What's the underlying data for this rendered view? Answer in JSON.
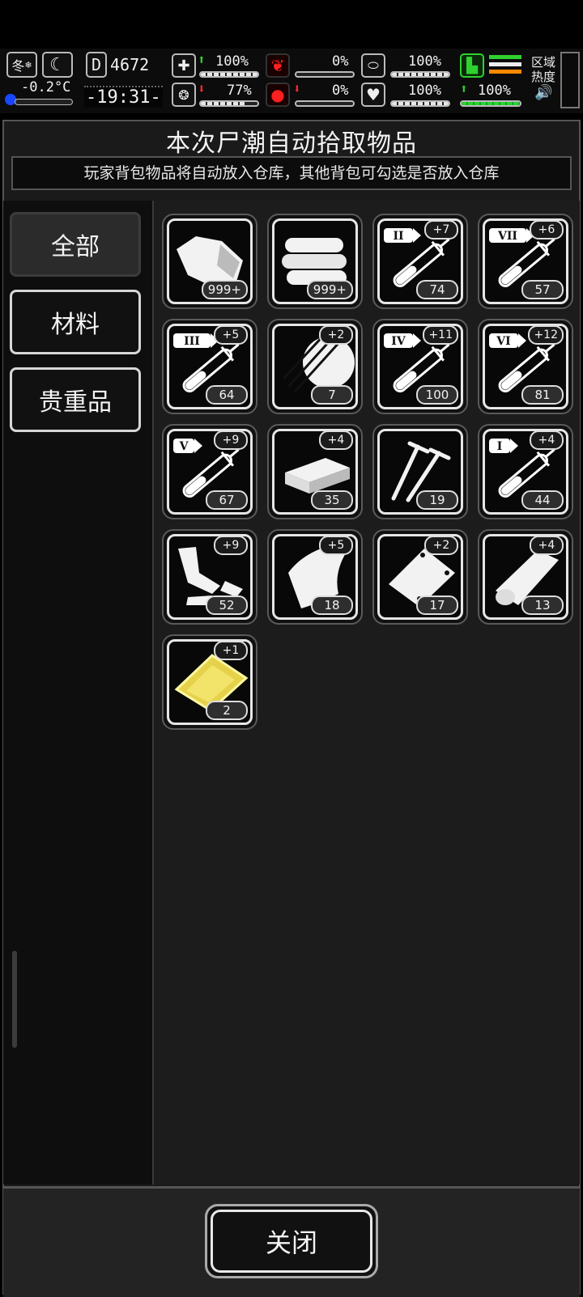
{
  "status": {
    "season": "冬",
    "temperature": "-0.2°C",
    "day": "4672",
    "clock": "-19:31-",
    "health": "100%",
    "mood": "77%",
    "hunger": "0%",
    "blood": "0%",
    "stamina": "100%",
    "heart": "100%",
    "speed": "100%",
    "zone_heat_label": "区域热度"
  },
  "dialog": {
    "title": "本次尸潮自动拾取物品",
    "notice": "玩家背包物品将自动放入仓库，其他背包可勾选是否放入仓库"
  },
  "tabs": [
    {
      "label": "全部",
      "active": true
    },
    {
      "label": "材料",
      "active": false
    },
    {
      "label": "贵重品",
      "active": false
    }
  ],
  "items": [
    {
      "icon": "meat-icon",
      "count": "999+",
      "bonus": ""
    },
    {
      "icon": "cloth-icon",
      "count": "999+",
      "bonus": ""
    },
    {
      "icon": "syringe-ii-icon",
      "tier": "II",
      "count": "74",
      "bonus": "+7"
    },
    {
      "icon": "syringe-vii-icon",
      "tier": "VII",
      "count": "57",
      "bonus": "+6"
    },
    {
      "icon": "syringe-iii-icon",
      "tier": "III",
      "count": "64",
      "bonus": "+5"
    },
    {
      "icon": "wood-planks-icon",
      "count": "7",
      "bonus": "+2"
    },
    {
      "icon": "syringe-iv-icon",
      "tier": "IV",
      "count": "100",
      "bonus": "+11"
    },
    {
      "icon": "syringe-vi-icon",
      "tier": "VI",
      "count": "81",
      "bonus": "+12"
    },
    {
      "icon": "syringe-v-icon",
      "tier": "V",
      "count": "67",
      "bonus": "+9"
    },
    {
      "icon": "wood-block-icon",
      "count": "35",
      "bonus": "+4"
    },
    {
      "icon": "screws-icon",
      "count": "19",
      "bonus": ""
    },
    {
      "icon": "syringe-i-icon",
      "tier": "I",
      "count": "44",
      "bonus": "+4"
    },
    {
      "icon": "scrap-metal-icon",
      "count": "52",
      "bonus": "+9"
    },
    {
      "icon": "cloth-sheet-icon",
      "count": "18",
      "bonus": "+5"
    },
    {
      "icon": "metal-plate-icon",
      "count": "17",
      "bonus": "+2"
    },
    {
      "icon": "leather-roll-icon",
      "count": "13",
      "bonus": "+4"
    },
    {
      "icon": "gold-plate-icon",
      "count": "2",
      "bonus": "+1"
    }
  ],
  "close_label": "关闭"
}
